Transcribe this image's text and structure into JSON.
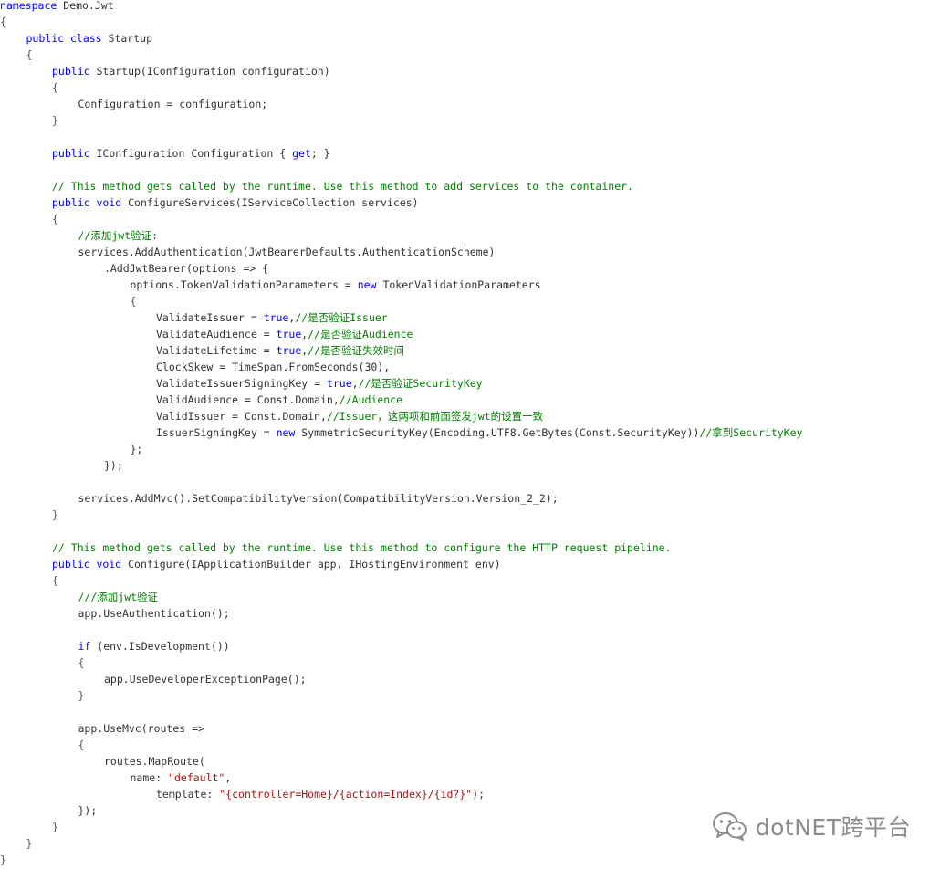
{
  "code": {
    "lines": [
      {
        "indent": 0,
        "tokens": [
          {
            "t": "kw",
            "v": "namespace"
          },
          {
            "t": "pl",
            "v": " Demo.Jwt"
          }
        ]
      },
      {
        "indent": 0,
        "tokens": [
          {
            "t": "brace",
            "v": "{"
          }
        ]
      },
      {
        "indent": 1,
        "tokens": [
          {
            "t": "kw",
            "v": "public"
          },
          {
            "t": "pl",
            "v": " "
          },
          {
            "t": "kw",
            "v": "class"
          },
          {
            "t": "pl",
            "v": " Startup"
          }
        ]
      },
      {
        "indent": 1,
        "tokens": [
          {
            "t": "brace",
            "v": "{"
          }
        ]
      },
      {
        "indent": 2,
        "tokens": [
          {
            "t": "kw",
            "v": "public"
          },
          {
            "t": "pl",
            "v": " Startup(IConfiguration configuration)"
          }
        ]
      },
      {
        "indent": 2,
        "tokens": [
          {
            "t": "brace",
            "v": "{"
          }
        ]
      },
      {
        "indent": 3,
        "tokens": [
          {
            "t": "pl",
            "v": "Configuration = configuration;"
          }
        ]
      },
      {
        "indent": 2,
        "tokens": [
          {
            "t": "brace",
            "v": "}"
          }
        ]
      },
      {
        "indent": 0,
        "tokens": []
      },
      {
        "indent": 2,
        "tokens": [
          {
            "t": "kw",
            "v": "public"
          },
          {
            "t": "pl",
            "v": " IConfiguration Configuration { "
          },
          {
            "t": "kw",
            "v": "get"
          },
          {
            "t": "pl",
            "v": "; }"
          }
        ]
      },
      {
        "indent": 0,
        "tokens": []
      },
      {
        "indent": 2,
        "tokens": [
          {
            "t": "cm",
            "v": "// This method gets called by the runtime. Use this method to add services to the container."
          }
        ]
      },
      {
        "indent": 2,
        "tokens": [
          {
            "t": "kw",
            "v": "public"
          },
          {
            "t": "pl",
            "v": " "
          },
          {
            "t": "kw",
            "v": "void"
          },
          {
            "t": "pl",
            "v": " ConfigureServices(IServiceCollection services)"
          }
        ]
      },
      {
        "indent": 2,
        "tokens": [
          {
            "t": "brace",
            "v": "{"
          }
        ]
      },
      {
        "indent": 3,
        "tokens": [
          {
            "t": "cm",
            "v": "//添加jwt验证:"
          }
        ]
      },
      {
        "indent": 3,
        "tokens": [
          {
            "t": "pl",
            "v": "services.AddAuthentication(JwtBearerDefaults.AuthenticationScheme)"
          }
        ]
      },
      {
        "indent": 4,
        "tokens": [
          {
            "t": "pl",
            "v": ".AddJwtBearer(options => {"
          }
        ]
      },
      {
        "indent": 5,
        "tokens": [
          {
            "t": "pl",
            "v": "options.TokenValidationParameters = "
          },
          {
            "t": "kw",
            "v": "new"
          },
          {
            "t": "pl",
            "v": " TokenValidationParameters"
          }
        ]
      },
      {
        "indent": 5,
        "tokens": [
          {
            "t": "brace",
            "v": "{"
          }
        ]
      },
      {
        "indent": 6,
        "tokens": [
          {
            "t": "pl",
            "v": "ValidateIssuer = "
          },
          {
            "t": "kw",
            "v": "true"
          },
          {
            "t": "pl",
            "v": ","
          },
          {
            "t": "cm",
            "v": "//是否验证Issuer"
          }
        ]
      },
      {
        "indent": 6,
        "tokens": [
          {
            "t": "pl",
            "v": "ValidateAudience = "
          },
          {
            "t": "kw",
            "v": "true"
          },
          {
            "t": "pl",
            "v": ","
          },
          {
            "t": "cm",
            "v": "//是否验证Audience"
          }
        ]
      },
      {
        "indent": 6,
        "tokens": [
          {
            "t": "pl",
            "v": "ValidateLifetime = "
          },
          {
            "t": "kw",
            "v": "true"
          },
          {
            "t": "pl",
            "v": ","
          },
          {
            "t": "cm",
            "v": "//是否验证失效时间"
          }
        ]
      },
      {
        "indent": 6,
        "tokens": [
          {
            "t": "pl",
            "v": "ClockSkew = TimeSpan.FromSeconds(30),"
          }
        ]
      },
      {
        "indent": 6,
        "tokens": [
          {
            "t": "pl",
            "v": "ValidateIssuerSigningKey = "
          },
          {
            "t": "kw",
            "v": "true"
          },
          {
            "t": "pl",
            "v": ","
          },
          {
            "t": "cm",
            "v": "//是否验证SecurityKey"
          }
        ]
      },
      {
        "indent": 6,
        "tokens": [
          {
            "t": "pl",
            "v": "ValidAudience = Const.Domain,"
          },
          {
            "t": "cm",
            "v": "//Audience"
          }
        ]
      },
      {
        "indent": 6,
        "tokens": [
          {
            "t": "pl",
            "v": "ValidIssuer = Const.Domain,"
          },
          {
            "t": "cm",
            "v": "//Issuer，这两项和前面签发jwt的设置一致"
          }
        ]
      },
      {
        "indent": 6,
        "tokens": [
          {
            "t": "pl",
            "v": "IssuerSigningKey = "
          },
          {
            "t": "kw",
            "v": "new"
          },
          {
            "t": "pl",
            "v": " SymmetricSecurityKey(Encoding.UTF8.GetBytes(Const.SecurityKey))"
          },
          {
            "t": "cm",
            "v": "//拿到SecurityKey"
          }
        ]
      },
      {
        "indent": 5,
        "tokens": [
          {
            "t": "pl",
            "v": "};"
          }
        ]
      },
      {
        "indent": 4,
        "tokens": [
          {
            "t": "pl",
            "v": "});"
          }
        ]
      },
      {
        "indent": 0,
        "tokens": []
      },
      {
        "indent": 3,
        "tokens": [
          {
            "t": "pl",
            "v": "services.AddMvc().SetCompatibilityVersion(CompatibilityVersion.Version_2_2);"
          }
        ]
      },
      {
        "indent": 2,
        "tokens": [
          {
            "t": "brace",
            "v": "}"
          }
        ]
      },
      {
        "indent": 0,
        "tokens": []
      },
      {
        "indent": 2,
        "tokens": [
          {
            "t": "cm",
            "v": "// This method gets called by the runtime. Use this method to configure the HTTP request pipeline."
          }
        ]
      },
      {
        "indent": 2,
        "tokens": [
          {
            "t": "kw",
            "v": "public"
          },
          {
            "t": "pl",
            "v": " "
          },
          {
            "t": "kw",
            "v": "void"
          },
          {
            "t": "pl",
            "v": " Configure(IApplicationBuilder app, IHostingEnvironment env)"
          }
        ]
      },
      {
        "indent": 2,
        "tokens": [
          {
            "t": "brace",
            "v": "{"
          }
        ]
      },
      {
        "indent": 3,
        "tokens": [
          {
            "t": "cm",
            "v": "///添加jwt验证"
          }
        ]
      },
      {
        "indent": 3,
        "tokens": [
          {
            "t": "pl",
            "v": "app.UseAuthentication();"
          }
        ]
      },
      {
        "indent": 0,
        "tokens": []
      },
      {
        "indent": 3,
        "tokens": [
          {
            "t": "kw",
            "v": "if"
          },
          {
            "t": "pl",
            "v": " (env.IsDevelopment())"
          }
        ]
      },
      {
        "indent": 3,
        "tokens": [
          {
            "t": "brace",
            "v": "{"
          }
        ]
      },
      {
        "indent": 4,
        "tokens": [
          {
            "t": "pl",
            "v": "app.UseDeveloperExceptionPage();"
          }
        ]
      },
      {
        "indent": 3,
        "tokens": [
          {
            "t": "brace",
            "v": "}"
          }
        ]
      },
      {
        "indent": 0,
        "tokens": []
      },
      {
        "indent": 3,
        "tokens": [
          {
            "t": "pl",
            "v": "app.UseMvc(routes =>"
          }
        ]
      },
      {
        "indent": 3,
        "tokens": [
          {
            "t": "brace",
            "v": "{"
          }
        ]
      },
      {
        "indent": 4,
        "tokens": [
          {
            "t": "pl",
            "v": "routes.MapRoute("
          }
        ]
      },
      {
        "indent": 5,
        "tokens": [
          {
            "t": "pl",
            "v": "name: "
          },
          {
            "t": "st",
            "v": "\"default\""
          },
          {
            "t": "pl",
            "v": ","
          }
        ]
      },
      {
        "indent": 6,
        "tokens": [
          {
            "t": "pl",
            "v": "template: "
          },
          {
            "t": "st",
            "v": "\"{controller=Home}/{action=Index}/{id?}\""
          },
          {
            "t": "pl",
            "v": ");"
          }
        ]
      },
      {
        "indent": 3,
        "tokens": [
          {
            "t": "pl",
            "v": "});"
          }
        ]
      },
      {
        "indent": 2,
        "tokens": [
          {
            "t": "brace",
            "v": "}"
          }
        ]
      },
      {
        "indent": 1,
        "tokens": [
          {
            "t": "brace",
            "v": "}"
          }
        ]
      },
      {
        "indent": 0,
        "tokens": [
          {
            "t": "brace",
            "v": "}"
          }
        ]
      }
    ]
  },
  "watermark": {
    "text": "dotNET跨平台",
    "icon": "wechat-icon"
  },
  "colors": {
    "keyword": "#0000ff",
    "comment": "#008000",
    "string": "#a31515",
    "plain": "#333333"
  }
}
